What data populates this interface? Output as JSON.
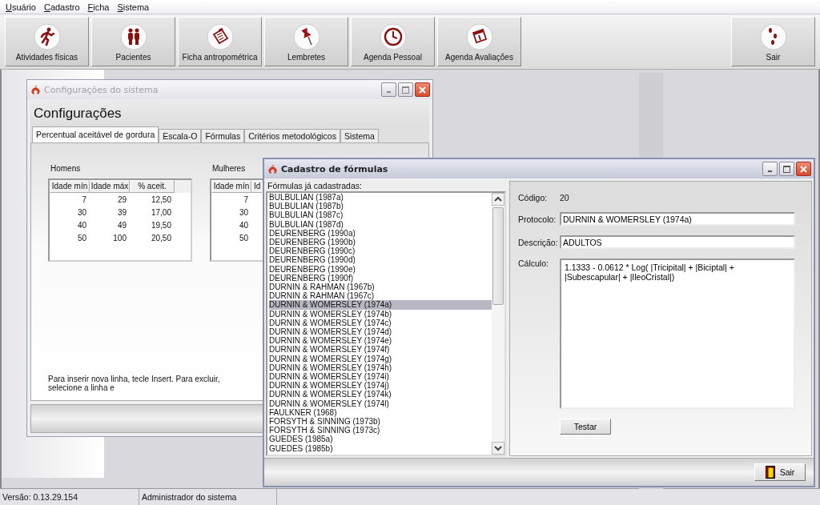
{
  "menu": [
    {
      "label": "Usuário"
    },
    {
      "label": "Cadastro"
    },
    {
      "label": "Ficha"
    },
    {
      "label": "Sistema"
    }
  ],
  "toolbar": {
    "buttons": [
      {
        "label": "Atividades físicas",
        "kind": "runner"
      },
      {
        "label": "Pacientes",
        "kind": "people"
      },
      {
        "label": "Ficha antropométrica",
        "kind": "clipboard"
      },
      {
        "label": "Lembretes",
        "kind": "pin"
      },
      {
        "label": "Agenda Pessoal",
        "kind": "clock"
      },
      {
        "label": "Agenda Avaliações",
        "kind": "calendar"
      }
    ],
    "exit_button": {
      "label": "Sair",
      "kind": "footprints"
    }
  },
  "config_window": {
    "title": "Configurações do sistema",
    "heading": "Configurações",
    "tabs": [
      {
        "label": "Percentual aceitável de gordura",
        "selected": true
      },
      {
        "label": "Escala-O",
        "selected": false
      },
      {
        "label": "Fórmulas",
        "selected": false
      },
      {
        "label": "Critérios metodológicos",
        "selected": false
      },
      {
        "label": "Sistema",
        "selected": false
      }
    ],
    "men": {
      "label": "Homens",
      "columns": [
        "Idade mín",
        "Idade máx",
        "% aceit."
      ],
      "rows": [
        [
          "7",
          "29",
          "12,50"
        ],
        [
          "30",
          "39",
          "17,00"
        ],
        [
          "40",
          "49",
          "19,50"
        ],
        [
          "50",
          "100",
          "20,50"
        ]
      ]
    },
    "women": {
      "label": "Mulheres",
      "columns": [
        "Idade mín",
        "Id"
      ],
      "rows": [
        [
          "7"
        ],
        [
          "30"
        ],
        [
          "40"
        ],
        [
          "50"
        ]
      ]
    },
    "hint": "Para inserir nova linha, tecle Insert. Para excluir, selecione a linha e"
  },
  "formula_window": {
    "title": "Cadastro de fórmulas",
    "list_label": "Fórmulas já cadastradas:",
    "formulas": [
      {
        "name": "BULBULIAN (1987a)",
        "selected": false
      },
      {
        "name": "BULBULIAN (1987b)",
        "selected": false
      },
      {
        "name": "BULBULIAN (1987c)",
        "selected": false
      },
      {
        "name": "BULBULIAN (1987d)",
        "selected": false
      },
      {
        "name": "DEURENBERG (1990a)",
        "selected": false
      },
      {
        "name": "DEURENBERG (1990b)",
        "selected": false
      },
      {
        "name": "DEURENBERG (1990c)",
        "selected": false
      },
      {
        "name": "DEURENBERG (1990d)",
        "selected": false
      },
      {
        "name": "DEURENBERG (1990e)",
        "selected": false
      },
      {
        "name": "DEURENBERG (1990f)",
        "selected": false
      },
      {
        "name": "DURNIN & RAHMAN (1967b)",
        "selected": false
      },
      {
        "name": "DURNIN & RAHMAN (1967c)",
        "selected": false
      },
      {
        "name": "DURNIN & WOMERSLEY (1974a)",
        "selected": true
      },
      {
        "name": "DURNIN & WOMERSLEY (1974b)",
        "selected": false
      },
      {
        "name": "DURNIN & WOMERSLEY (1974c)",
        "selected": false
      },
      {
        "name": "DURNIN & WOMERSLEY (1974d)",
        "selected": false
      },
      {
        "name": "DURNIN & WOMERSLEY (1974e)",
        "selected": false
      },
      {
        "name": "DURNIN & WOMERSLEY (1974f)",
        "selected": false
      },
      {
        "name": "DURNIN & WOMERSLEY (1974g)",
        "selected": false
      },
      {
        "name": "DURNIN & WOMERSLEY (1974h)",
        "selected": false
      },
      {
        "name": "DURNIN & WOMERSLEY (1974i)",
        "selected": false
      },
      {
        "name": "DURNIN & WOMERSLEY (1974j)",
        "selected": false
      },
      {
        "name": "DURNIN & WOMERSLEY (1974k)",
        "selected": false
      },
      {
        "name": "DURNIN & WOMERSLEY (1974l)",
        "selected": false
      },
      {
        "name": "FAULKNER (1968)",
        "selected": false
      },
      {
        "name": "FORSYTH & SINNING (1973b)",
        "selected": false
      },
      {
        "name": "FORSYTH & SINNING (1973c)",
        "selected": false
      },
      {
        "name": "GUEDES (1985a)",
        "selected": false
      },
      {
        "name": "GUEDES (1985b)",
        "selected": false
      }
    ],
    "code_label": "Código:",
    "code": "20",
    "protocol_label": "Protocolo:",
    "protocol": "DURNIN & WOMERSLEY (1974a)",
    "description_label": "Descrição:",
    "description": "ADULTOS",
    "calc_label": "Cálculo:",
    "calc": "1.1333 - 0.0612 * Log( |Tricipital| + |Biciptal| + |Subescapular| + |IleoCristal|)",
    "test_button": "Testar",
    "exit_button": "Sair"
  },
  "status_bar": [
    "Versão: 0.13.29.154",
    "Administrador do sistema"
  ]
}
